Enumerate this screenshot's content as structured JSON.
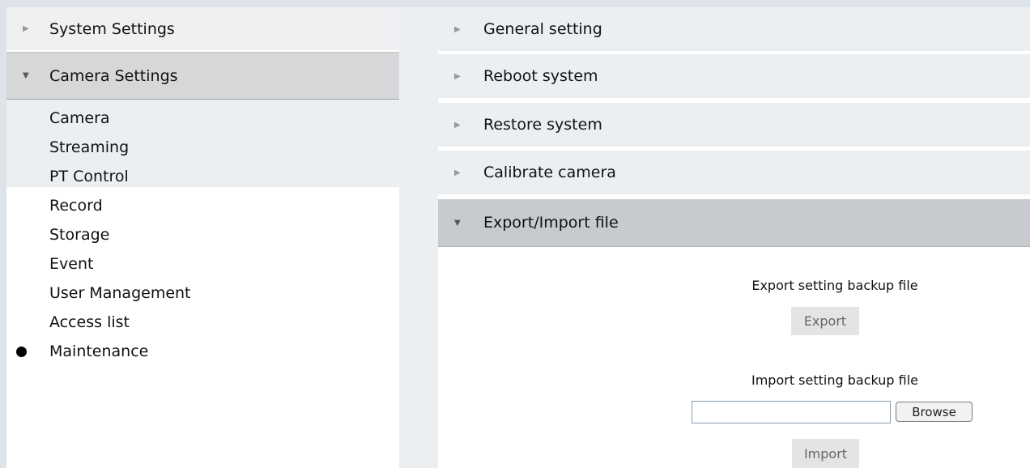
{
  "sidebar": {
    "system_settings": "System Settings",
    "camera_settings": "Camera Settings",
    "items": [
      {
        "label": "Camera"
      },
      {
        "label": "Streaming"
      },
      {
        "label": "PT Control"
      },
      {
        "label": "Record"
      },
      {
        "label": "Storage"
      },
      {
        "label": "Event"
      },
      {
        "label": "User Management"
      },
      {
        "label": "Access list"
      },
      {
        "label": "Maintenance",
        "selected": true
      }
    ]
  },
  "main": {
    "sections": [
      {
        "label": "General setting"
      },
      {
        "label": "Reboot system"
      },
      {
        "label": "Restore system"
      },
      {
        "label": "Calibrate camera"
      },
      {
        "label": "Export/Import file",
        "expanded": true
      }
    ],
    "export": {
      "label": "Export setting backup file",
      "button": "Export"
    },
    "import": {
      "label": "Import setting backup file",
      "file_value": "",
      "browse_button": "Browse",
      "button": "Import"
    }
  },
  "icons": {
    "collapsed": "triangle-right-icon",
    "expanded": "triangle-down-icon",
    "selected_marker": "bullet-icon"
  },
  "colors": {
    "header_bg": "#eceff2",
    "active_header_bg": "#c7cbcf",
    "selected_dot": "#000000"
  }
}
